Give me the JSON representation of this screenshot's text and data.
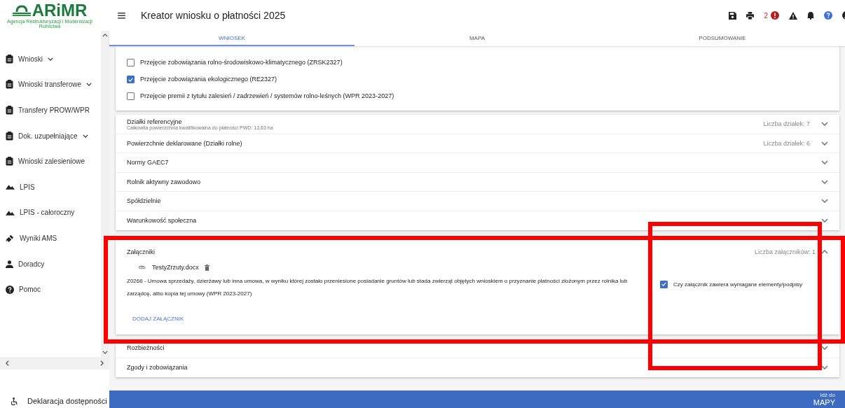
{
  "sidebar": {
    "logo": "ARiMR",
    "logo_subtitle": "Agencja Restrukturyzacji i Modernizacji Rolnictwa",
    "items": [
      {
        "label": "Wnioski",
        "kind": "clipboard",
        "expandable": true
      },
      {
        "label": "Wnioski transferowe",
        "kind": "clipboard",
        "expandable": true
      },
      {
        "label": "Transfery PROW/WPR",
        "kind": "clipboard",
        "expandable": false
      },
      {
        "label": "Dok. uzupełniające",
        "kind": "clipboard",
        "expandable": true
      },
      {
        "label": "Wnioski zalesieniowe",
        "kind": "clipboard",
        "expandable": false
      },
      {
        "label": "LPIS",
        "kind": "mountain",
        "expandable": false
      },
      {
        "label": "LPIS - całoroczny",
        "kind": "mountain",
        "expandable": false
      },
      {
        "label": "Wyniki AMS",
        "kind": "satellite",
        "expandable": false
      },
      {
        "label": "Doradcy",
        "kind": "person",
        "expandable": false
      },
      {
        "label": "Pomoc",
        "kind": "help",
        "expandable": false
      }
    ],
    "footer_link": "Deklaracja dostępności"
  },
  "header": {
    "title": "Kreator wniosku o płatności 2025",
    "error_count": "2"
  },
  "tabs": [
    {
      "label": "WNIOSEK",
      "selected": true
    },
    {
      "label": "MAPA",
      "selected": false
    },
    {
      "label": "PODSUMOWANIE",
      "selected": false
    }
  ],
  "takeover_options": [
    {
      "label": "Przejęcie zobowiązania rolno-środowiskowo-klimatycznego (ZRSK2327)",
      "checked": false
    },
    {
      "label": "Przejęcie zobowiązania ekologicznego (RE2327)",
      "checked": true
    },
    {
      "label": "Przejęcie premii z tytułu zalesień / zadrzewień / systemów rolno-leśnych (WPR 2023-2027)",
      "checked": false
    }
  ],
  "sections": [
    {
      "title": "Działki referencyjne",
      "subtitle": "Całkowita powierzchnia kwalifikowalna do płatności PWD: 13,63 ha",
      "count": "Liczba działek: 7",
      "expanded": false
    },
    {
      "title": "Powierzchnie deklarowane (Działki rolne)",
      "count": "Liczba działek: 6",
      "expanded": false
    },
    {
      "title": "Normy GAEC7",
      "expanded": false
    },
    {
      "title": "Rolnik aktywny zawodowo",
      "expanded": false
    },
    {
      "title": "Spółdzielnie",
      "expanded": false
    },
    {
      "title": "Warunkowość społeczna",
      "expanded": false
    }
  ],
  "attachments": {
    "title": "Załączniki",
    "count": "Liczba załączników: 1",
    "expanded": true,
    "file_name": "TestyZrzuty.docx",
    "description": "Z0266 - Umowa sprzedaży, dzierżawy lub inna umowa, w wyniku której zostało przeniesione posiadanie gruntów lub stada zwierząt objętych wnioskiem o przyznanie płatności złożonym przez rolnika lub zarządcę, albo kopia tej umowy (WPR 2023-2027)",
    "confirm_label": "Czy załącznik zawiera wymagane elementy/podpisy",
    "confirm_checked": true,
    "add_button": "DODAJ ZAŁĄCZNIK"
  },
  "sections_bottom": [
    {
      "title": "Rozbieżności",
      "expanded": false
    },
    {
      "title": "Zgody i zobowiązania",
      "expanded": false
    }
  ],
  "bottom_bar": {
    "hint": "Idź do",
    "target": "MAPY"
  }
}
